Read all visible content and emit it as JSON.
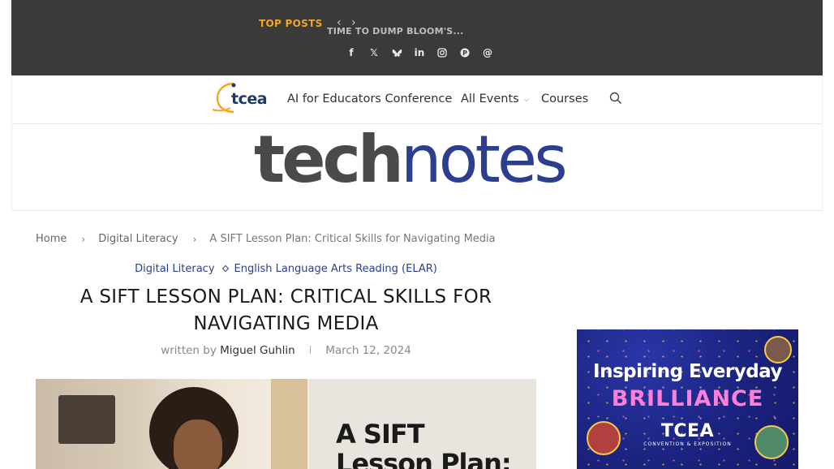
{
  "topbar": {
    "label": "TOP POSTS",
    "prev_icon": "chevron-left-icon",
    "next_icon": "chevron-right-icon",
    "post_title": "TIME TO DUMP BLOOM'S...",
    "social": [
      {
        "name": "facebook-icon",
        "glyph": "f"
      },
      {
        "name": "x-twitter-icon",
        "glyph": "𝕏"
      },
      {
        "name": "bluesky-icon",
        "glyph": "🦋"
      },
      {
        "name": "linkedin-icon",
        "glyph": "in"
      },
      {
        "name": "instagram-icon",
        "glyph": "◎"
      },
      {
        "name": "pinterest-icon",
        "glyph": "P"
      },
      {
        "name": "threads-icon",
        "glyph": "@"
      }
    ]
  },
  "nav": {
    "logo_text": "tcea",
    "items": [
      {
        "label": "AI for Educators Conference"
      },
      {
        "label": "All Events",
        "has_dropdown": true
      },
      {
        "label": "Courses"
      }
    ],
    "search_icon": "search-icon"
  },
  "masthead": {
    "part1": "tech",
    "part2": "notes"
  },
  "breadcrumb": [
    {
      "label": "Home"
    },
    {
      "label": "Digital Literacy"
    },
    {
      "label": "A SIFT Lesson Plan: Critical Skills for Navigating Media"
    }
  ],
  "article": {
    "categories": [
      "Digital Literacy",
      "English Language Arts Reading (ELAR)"
    ],
    "title": "A SIFT Lesson Plan: Critical Skills for Navigating Media",
    "written_by": "written by",
    "author": "Miguel Guhlin",
    "date": "March 12, 2024",
    "image_text_line1": "A SIFT",
    "image_text_line2": "Lesson Plan:"
  },
  "ad": {
    "line1": "Inspiring Everyday",
    "line2": "BRILLIANCE",
    "line3": "TCEA",
    "line4": "CONVENTION & EXPOSITION"
  },
  "colors": {
    "topbar_bg": "#3a3a3a",
    "accent_orange": "#f5a524",
    "brand_blue": "#2c3f8f",
    "ad_pink": "#ff7fd6"
  }
}
